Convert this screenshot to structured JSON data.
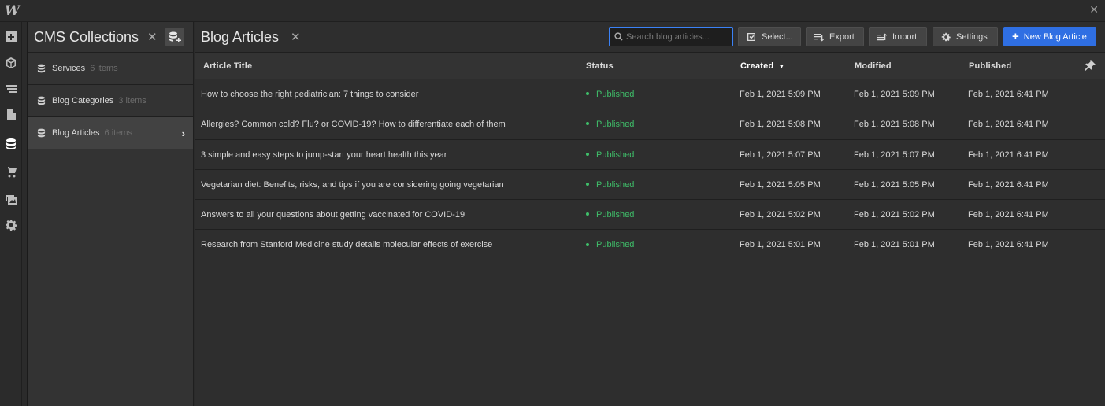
{
  "app": {
    "logo": "W",
    "close_label": "✕"
  },
  "rail": {
    "icons": [
      "add-panel-icon",
      "cube-icon",
      "navigator-icon",
      "pages-icon",
      "cms-database-icon",
      "ecommerce-cart-icon",
      "assets-icon",
      "settings-gear-icon"
    ],
    "active": "cms-database-icon"
  },
  "collections": {
    "title": "CMS Collections",
    "close_label": "✕",
    "items": [
      {
        "name": "Services",
        "count": "6 items",
        "active": false
      },
      {
        "name": "Blog Categories",
        "count": "3 items",
        "active": false
      },
      {
        "name": "Blog Articles",
        "count": "6 items",
        "active": true
      }
    ]
  },
  "main": {
    "title": "Blog Articles",
    "close_label": "✕",
    "search": {
      "placeholder": "Search blog articles...",
      "value": ""
    },
    "toolbar": {
      "select_label": "Select...",
      "export_label": "Export",
      "import_label": "Import",
      "settings_label": "Settings",
      "new_label": "New Blog Article"
    },
    "columns": {
      "title": "Article Title",
      "status": "Status",
      "created": "Created",
      "modified": "Modified",
      "published": "Published"
    },
    "sorted_column": "created",
    "rows": [
      {
        "title": "How to choose the right pediatrician: 7 things to consider",
        "status": "Published",
        "created": "Feb 1, 2021 5:09 PM",
        "modified": "Feb 1, 2021 5:09 PM",
        "published": "Feb 1, 2021 6:41 PM"
      },
      {
        "title": "Allergies? Common cold? Flu? or COVID-19? How to differentiate each of them",
        "status": "Published",
        "created": "Feb 1, 2021 5:08 PM",
        "modified": "Feb 1, 2021 5:08 PM",
        "published": "Feb 1, 2021 6:41 PM"
      },
      {
        "title": "3 simple and easy steps to jump-start your heart health this year",
        "status": "Published",
        "created": "Feb 1, 2021 5:07 PM",
        "modified": "Feb 1, 2021 5:07 PM",
        "published": "Feb 1, 2021 6:41 PM"
      },
      {
        "title": "Vegetarian diet: Benefits, risks, and tips if you are considering going vegetarian",
        "status": "Published",
        "created": "Feb 1, 2021 5:05 PM",
        "modified": "Feb 1, 2021 5:05 PM",
        "published": "Feb 1, 2021 6:41 PM"
      },
      {
        "title": "Answers to all your questions about getting vaccinated for COVID-19",
        "status": "Published",
        "created": "Feb 1, 2021 5:02 PM",
        "modified": "Feb 1, 2021 5:02 PM",
        "published": "Feb 1, 2021 6:41 PM"
      },
      {
        "title": "Research from Stanford Medicine study details molecular effects of exercise",
        "status": "Published",
        "created": "Feb 1, 2021 5:01 PM",
        "modified": "Feb 1, 2021 5:01 PM",
        "published": "Feb 1, 2021 6:41 PM"
      }
    ]
  },
  "colors": {
    "accent": "#2f6fe3",
    "published": "#3fbf6a",
    "background": "#2e2e2e"
  }
}
